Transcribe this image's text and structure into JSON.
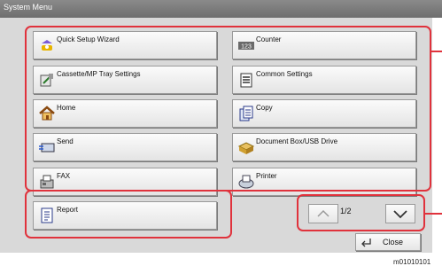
{
  "window": {
    "title": "System Menu"
  },
  "menu": {
    "left": [
      {
        "label": "Quick Setup Wizard",
        "icon": "wizard-icon"
      },
      {
        "label": "Cassette/MP Tray Settings",
        "icon": "tray-settings-icon"
      },
      {
        "label": "Home",
        "icon": "home-icon"
      },
      {
        "label": "Send",
        "icon": "send-icon"
      },
      {
        "label": "FAX",
        "icon": "fax-icon"
      },
      {
        "label": "Report",
        "icon": "report-icon"
      }
    ],
    "right": [
      {
        "label": "Counter",
        "icon": "counter-icon",
        "icon_text": "123"
      },
      {
        "label": "Common Settings",
        "icon": "common-settings-icon"
      },
      {
        "label": "Copy",
        "icon": "copy-icon"
      },
      {
        "label": "Document Box/USB Drive",
        "icon": "document-box-icon"
      },
      {
        "label": "Printer",
        "icon": "printer-icon"
      }
    ]
  },
  "pager": {
    "indicator": "1/2"
  },
  "close": {
    "label": "Close"
  },
  "figure_id": "m01010101",
  "colors": {
    "highlight": "#e0323c",
    "titlebar": "#7a7a7a",
    "panel": "#d9d9d9"
  }
}
